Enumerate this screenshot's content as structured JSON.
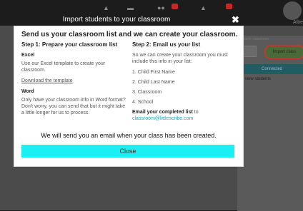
{
  "background": {
    "user_name": "Albe",
    "search_hint": "Search classroom",
    "import_button_label": "Import class",
    "table_header": "Connected",
    "hint_text": "to view students"
  },
  "modal": {
    "header_title": "Import students to your classroom",
    "close_x": "✖",
    "title": "Send us your classroom list and we can create your classroom.",
    "step1": {
      "heading": "Step 1: Prepare your classroom list",
      "excel_heading": "Excel",
      "excel_text": "Use our Excel template to create your classroom.",
      "download_link": "Download the template",
      "word_heading": "Word",
      "word_text": "Only have your classroom info in Word format? Don't worry, you can send that but it might take a little longer for us to process."
    },
    "step2": {
      "heading": "Step 2: Email us your list",
      "intro": "So we can create your classroom you must include this info in your list:",
      "items": [
        "1. Child First Name",
        "2. Child Last Name",
        "3. Classroom",
        "4. School"
      ],
      "email_label": "Email your completed list",
      "email_to": "to",
      "email_address": "classroom@littlescribe.com"
    },
    "notice": "We will send you an email when your class has been created.",
    "close_button": "Close"
  },
  "colors": {
    "accent": "#1af0f3",
    "link": "#1fa0b5",
    "highlight_ring": "#c0392b"
  }
}
